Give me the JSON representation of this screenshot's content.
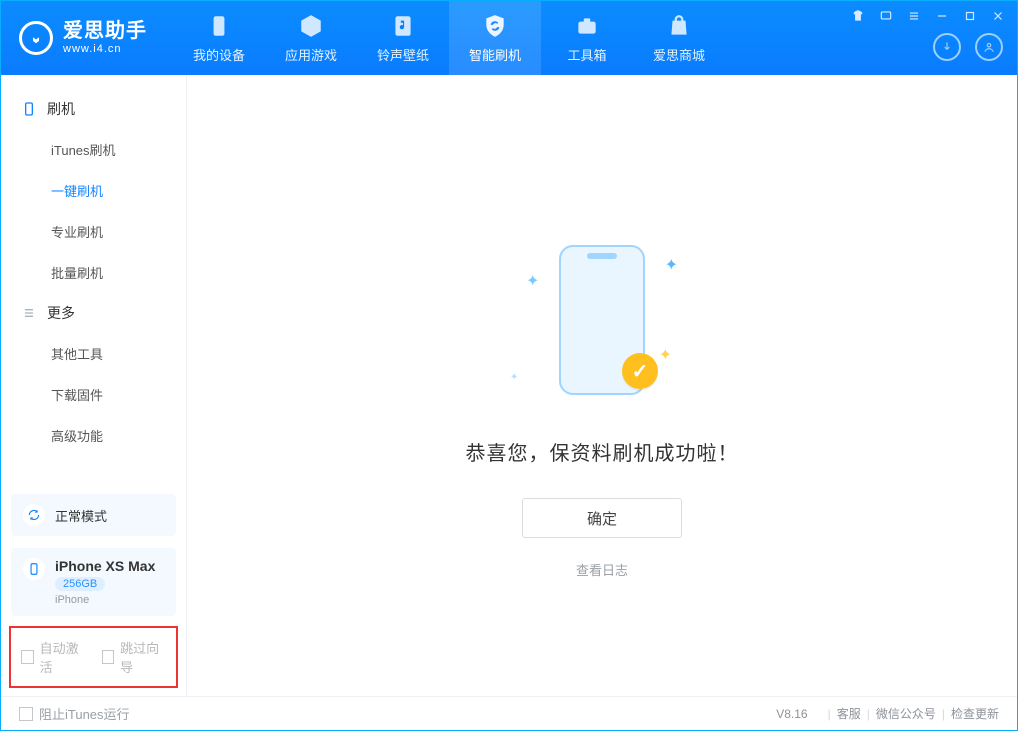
{
  "app": {
    "name_cn": "爱思助手",
    "url": "www.i4.cn"
  },
  "nav": {
    "items": [
      {
        "label": "我的设备"
      },
      {
        "label": "应用游戏"
      },
      {
        "label": "铃声壁纸"
      },
      {
        "label": "智能刷机"
      },
      {
        "label": "工具箱"
      },
      {
        "label": "爱思商城"
      }
    ]
  },
  "sidebar": {
    "groups": [
      {
        "title": "刷机",
        "items": [
          {
            "label": "iTunes刷机"
          },
          {
            "label": "一键刷机"
          },
          {
            "label": "专业刷机"
          },
          {
            "label": "批量刷机"
          }
        ]
      },
      {
        "title": "更多",
        "items": [
          {
            "label": "其他工具"
          },
          {
            "label": "下载固件"
          },
          {
            "label": "高级功能"
          }
        ]
      }
    ],
    "mode_label": "正常模式",
    "device": {
      "name": "iPhone XS Max",
      "storage": "256GB",
      "type": "iPhone"
    },
    "opts": {
      "auto_activate": "自动激活",
      "skip_guide": "跳过向导"
    }
  },
  "main": {
    "success": "恭喜您，保资料刷机成功啦！",
    "ok_button": "确定",
    "log_link": "查看日志"
  },
  "footer": {
    "block_itunes": "阻止iTunes运行",
    "version": "V8.16",
    "links": {
      "support": "客服",
      "wechat": "微信公众号",
      "update": "检查更新"
    }
  }
}
